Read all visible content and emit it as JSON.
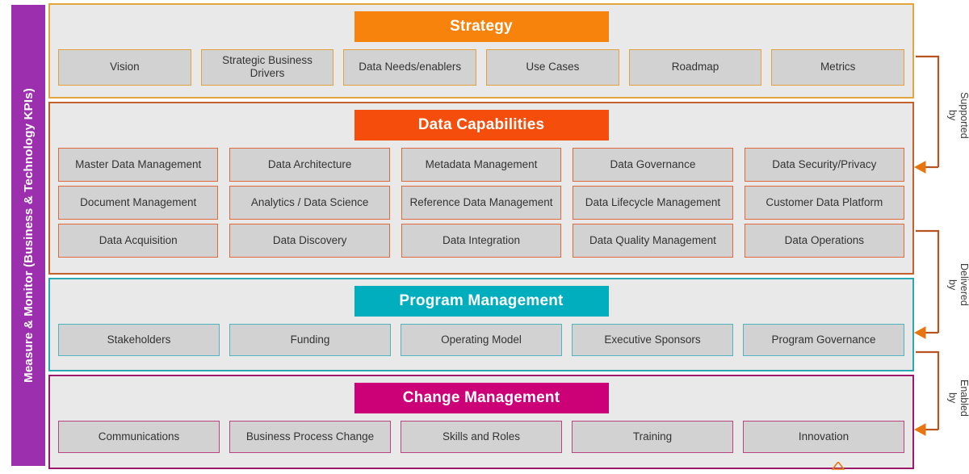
{
  "rail": {
    "label": "Measure & Monitor (Business & Technology KPIs)",
    "color": "#9B2FAE"
  },
  "sections": [
    {
      "id": "strategy",
      "title": "Strategy",
      "banner_color": "#F7830D",
      "border_color": "#E3A63E",
      "rows": [
        [
          "Vision",
          "Strategic Business Drivers",
          "Data Needs/enablers",
          "Use Cases",
          "Roadmap",
          "Metrics"
        ]
      ]
    },
    {
      "id": "capabilities",
      "title": "Data Capabilities",
      "banner_color": "#F54D0B",
      "border_color": "#C4602E",
      "rows": [
        [
          "Master Data Management",
          "Data Architecture",
          "Metadata Management",
          "Data Governance",
          "Data Security/Privacy"
        ],
        [
          "Document Management",
          "Analytics / Data Science",
          "Reference Data Management",
          "Data Lifecycle Management",
          "Customer Data Platform"
        ],
        [
          "Data Acquisition",
          "Data Discovery",
          "Data Integration",
          "Data Quality Management",
          "Data Operations"
        ]
      ]
    },
    {
      "id": "program",
      "title": "Program Management",
      "banner_color": "#00AEBE",
      "border_color": "#2AA9B5",
      "rows": [
        [
          "Stakeholders",
          "Funding",
          "Operating Model",
          "Executive Sponsors",
          "Program Governance"
        ]
      ]
    },
    {
      "id": "change",
      "title": "Change Management",
      "banner_color": "#CC0077",
      "border_color": "#9C1A6B",
      "rows": [
        [
          "Communications",
          "Business Process Change",
          "Skills and Roles",
          "Training",
          "Innovation"
        ]
      ]
    }
  ],
  "connectors": [
    {
      "label_line1": "Supported",
      "label_line2": "by"
    },
    {
      "label_line1": "Delivered",
      "label_line2": "by"
    },
    {
      "label_line1": "Enabled",
      "label_line2": "by"
    }
  ]
}
